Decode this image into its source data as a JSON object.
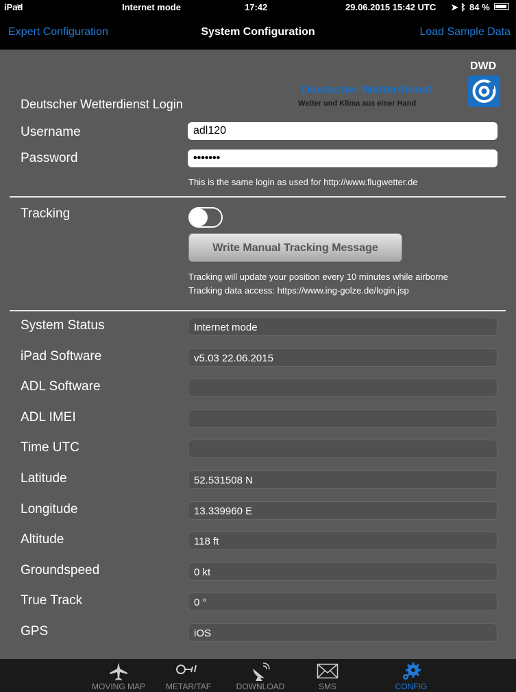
{
  "status_bar": {
    "device": "iPad",
    "mode": "Internet mode",
    "time": "17:42",
    "datetime_utc": "29.06.2015 15:42 UTC",
    "battery": "84 %"
  },
  "nav": {
    "left": "Expert Configuration",
    "title": "System Configuration",
    "right": "Load Sample Data"
  },
  "dwd": {
    "badge": "DWD",
    "name": "Deutscher Wetterdienst",
    "slogan": "Wetter und Klima aus einer Hand"
  },
  "login": {
    "heading": "Deutscher Wetterdienst Login",
    "username_label": "Username",
    "username_value": "adl120",
    "password_label": "Password",
    "password_value": "•••••••",
    "note": "This is the same login as used for http://www.flugwetter.de"
  },
  "tracking": {
    "label": "Tracking",
    "toggle_on": false,
    "button": "Write Manual Tracking Message",
    "note_line1": "Tracking will update your position every 10 minutes while airborne",
    "note_line2": "Tracking data access: https://www.ing-golze.de/login.jsp"
  },
  "status_fields": [
    {
      "label": "System Status",
      "value": "Internet mode"
    },
    {
      "label": "iPad Software",
      "value": "v5.03 22.06.2015"
    },
    {
      "label": "ADL Software",
      "value": ""
    },
    {
      "label": "ADL IMEI",
      "value": ""
    },
    {
      "label": "Time UTC",
      "value": ""
    },
    {
      "label": "Latitude",
      "value": "52.531508 N"
    },
    {
      "label": "Longitude",
      "value": "13.339960 E"
    },
    {
      "label": "Altitude",
      "value": "118 ft"
    },
    {
      "label": "Groundspeed",
      "value": "0 kt"
    },
    {
      "label": "True Track",
      "value": "0 °"
    },
    {
      "label": "GPS",
      "value": "iOS"
    }
  ],
  "tabs": [
    {
      "label": "MOVING MAP",
      "icon": "airplane-icon"
    },
    {
      "label": "METAR/TAF",
      "icon": "windsock-icon"
    },
    {
      "label": "DOWNLOAD",
      "icon": "satellite-dish-icon"
    },
    {
      "label": "SMS",
      "icon": "envelope-icon"
    },
    {
      "label": "CONFIG",
      "icon": "gear-icon",
      "active": true
    }
  ],
  "colors": {
    "accent": "#1f7bd8",
    "background": "#5a5a5a",
    "dwd_blue": "#1a6fc2"
  }
}
